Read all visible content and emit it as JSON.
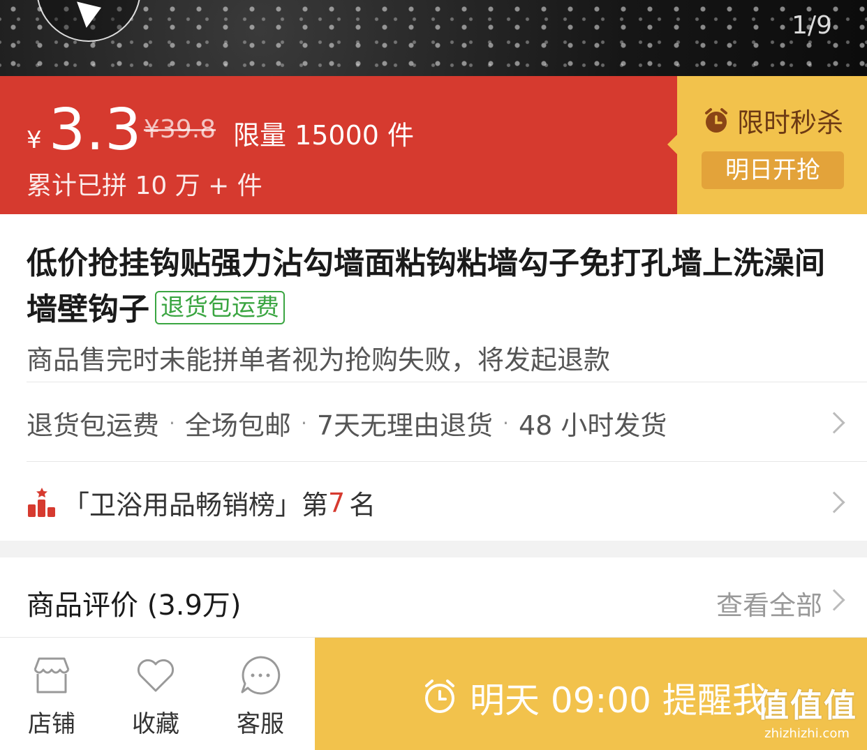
{
  "gallery": {
    "counter": "1/9"
  },
  "price": {
    "currency": "¥",
    "current": "3.3",
    "original": "¥39.8",
    "limit": "限量 15000 件",
    "sold": "累计已拼 10 万 + 件"
  },
  "flash_sale": {
    "title": "限时秒杀",
    "start_label": "明日开抢"
  },
  "product": {
    "title": "低价抢挂钩贴强力沾勾墙面粘钩粘墙勾子免打孔墙上洗澡间墙壁钩子",
    "tag": "退货包运费",
    "notice": "商品售完时未能拼单者视为抢购失败，将发起退款"
  },
  "services": [
    "退货包运费",
    "全场包邮",
    "7天无理由退货",
    "48 小时发货"
  ],
  "ranking": {
    "prefix": "「卫浴用品畅销榜」第",
    "number": "7",
    "suffix": "名"
  },
  "reviews": {
    "label": "商品评价 (3.9万)",
    "view_all": "查看全部"
  },
  "bottom_bar": {
    "tabs": [
      {
        "label": "店铺",
        "icon": "store-icon"
      },
      {
        "label": "收藏",
        "icon": "heart-icon"
      },
      {
        "label": "客服",
        "icon": "chat-icon"
      }
    ],
    "remind": "明天 09:00 提醒我"
  },
  "watermark": {
    "big": "值值值",
    "small": "zhizhizhi.com"
  },
  "colors": {
    "red": "#d63a2f",
    "yellow": "#f2c24c",
    "green": "#3aa541"
  }
}
